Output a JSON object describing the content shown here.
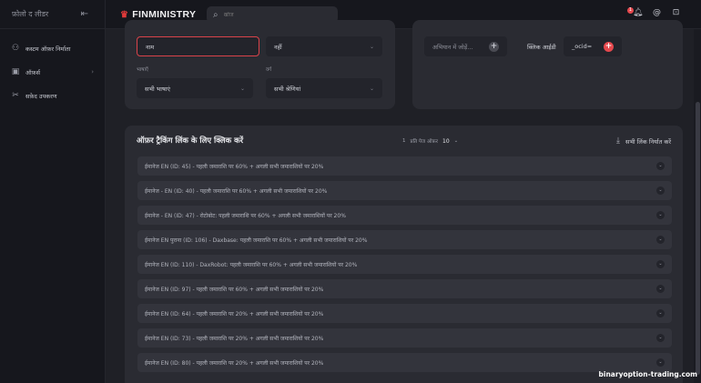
{
  "sidebar": {
    "title": "फ़ोलो द लीडर",
    "items": [
      {
        "label": "कस्टम ऑफ़र निर्माता",
        "icon": "users-icon"
      },
      {
        "label": "ऑफ़र्स",
        "icon": "gift-icon"
      },
      {
        "label": "सफ़ेद उपकरण",
        "icon": "tools-icon"
      }
    ]
  },
  "topbar": {
    "brand": "FINMINISTRY",
    "search_placeholder": "खोज",
    "notification_count": "1"
  },
  "filters": {
    "name_placeholder": "नाम",
    "select_value": "नहीं",
    "language_label": "भाषाएँ",
    "language_value": "सभी भाषाएं",
    "category_label": "वर्ग",
    "category_value": "सभी श्रेणियां",
    "param_placeholder": "अभियान में जोड़ें...",
    "click_id_label": "क्लिक आईडी",
    "click_id_value": "_ocid="
  },
  "offers": {
    "title": "ऑफ़र ट्रैकिंग लिंक के लिए क्लिक करें",
    "per_page_prefix": "1",
    "per_page_label": "प्रति पेज ऑफ़र",
    "per_page_value": "10",
    "export_label": "सभी लिंक निर्यात करें",
    "rows": [
      "ईमानेज EN (ID: 45) - पहली जमाराशि पर 60% + अगली सभी जमाराशियों पर 20%",
      "ईमानेज - EN (ID: 40) - पहली जमाराशि पर 60% + अगली सभी जमाराशियों पर 20%",
      "ईमानेज - EN (ID: 47) - रोटोबोट: पहली जमाराशि पर 60% + अगली सभी जमाराशियों पर 20%",
      "ईमानेज EN पुराना (ID: 106) - Daxbase: पहली जमाराशि पर 60% + अगली सभी जमाराशियों पर 20%",
      "ईमानेज EN (ID: 110) - DaxRobot: पहली जमाराशि पर 60% + अगली सभी जमाराशियों पर 20%",
      "ईमानेज EN (ID: 97) - पहली जमाराशि पर 60% + अगली सभी जमाराशियों पर 20%",
      "ईमानेज EN (ID: 64) - पहली जमाराशि पर 20% + अगली सभी जमाराशियों पर 20%",
      "ईमानेज EN (ID: 73) - पहली जमाराशि पर 20% + अगली सभी जमाराशियों पर 20%",
      "ईमानेज EN (ID: 80) - पहली जमाराशि पर 20% + अगली सभी जमाराशियों पर 20%"
    ]
  },
  "watermark": "binaryoption-trading.com",
  "colors": {
    "accent": "#e5484d",
    "background": "#1f2026",
    "card": "#2a2b32"
  }
}
